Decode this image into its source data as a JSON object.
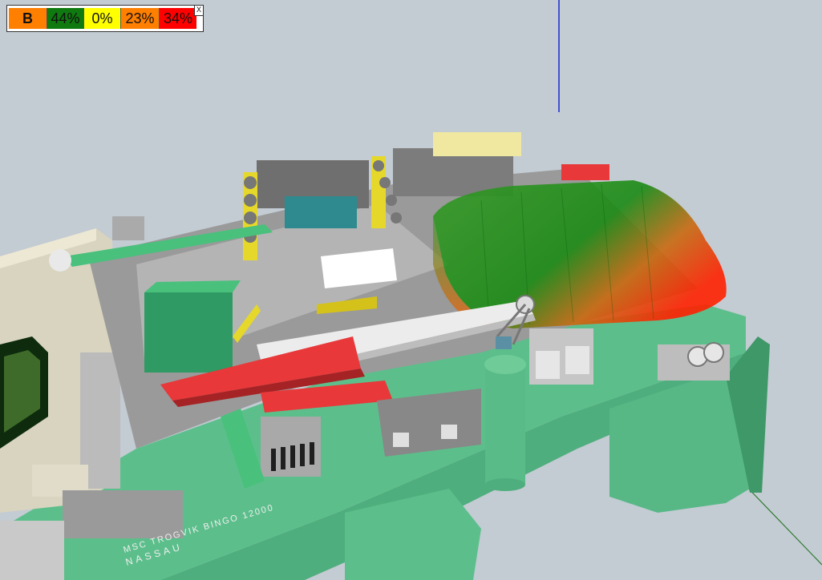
{
  "legend": {
    "badge": "B",
    "items": [
      {
        "value": "44%",
        "color": "#0f7a0f"
      },
      {
        "value": "0%",
        "color": "#ffff00"
      },
      {
        "value": "23%",
        "color": "#ff7f00"
      },
      {
        "value": "34%",
        "color": "#ff0000"
      }
    ],
    "badge_color": "#ff7f00",
    "close_label": "X"
  },
  "hull": {
    "name_text": "MSC TROGVIK BINGO 12000",
    "port_text": "NASSAU"
  },
  "colors": {
    "background": "#c3cbd3",
    "hull": "#5cbf8b",
    "deck": "#9a9a9a",
    "crane_boom": "#e8e8e8",
    "red_boom": "#e8383a",
    "yellow_crane": "#e6d82a",
    "teal_house": "#2e8a8e"
  }
}
